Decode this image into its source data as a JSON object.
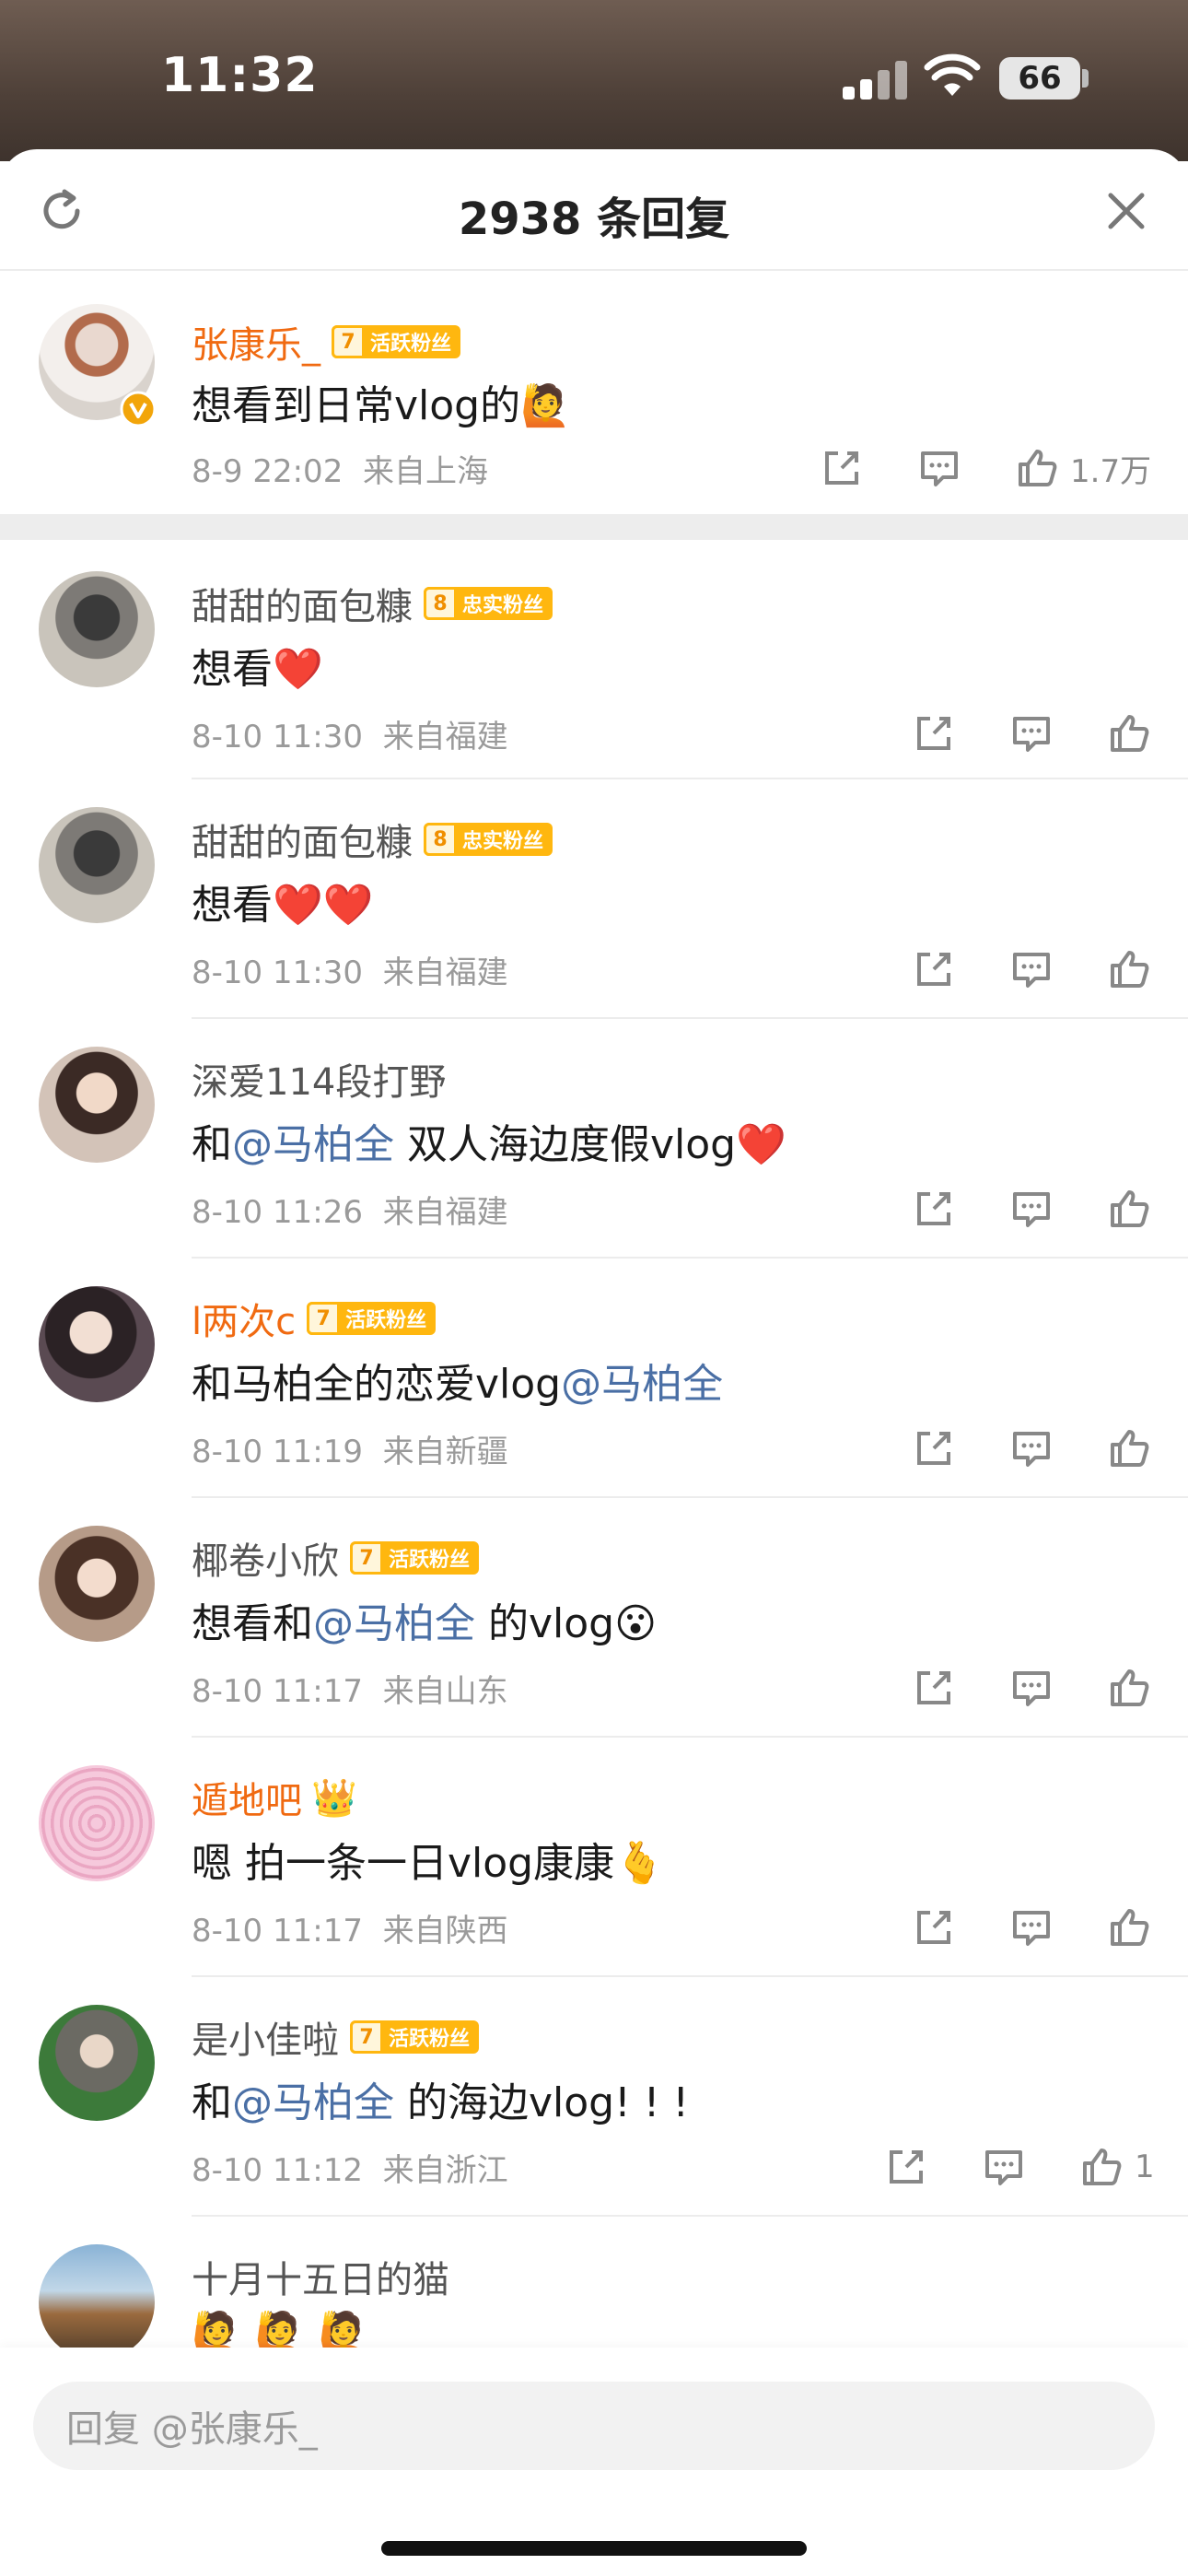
{
  "status": {
    "time": "11:32",
    "battery": "66"
  },
  "header": {
    "title": "2938 条回复"
  },
  "comments": [
    {
      "name": "张康乐_",
      "badge_level": "7",
      "badge_label": "活跃粉丝",
      "text": "想看到日常vlog的🙋",
      "date": "8-9 22:02",
      "location": "来自上海",
      "likes": "1.7万"
    },
    {
      "name": "甜甜的面包糠",
      "badge_level": "8",
      "badge_label": "忠实粉丝",
      "text": "想看❤️",
      "date": "8-10 11:30",
      "location": "来自福建"
    },
    {
      "name": "甜甜的面包糠",
      "badge_level": "8",
      "badge_label": "忠实粉丝",
      "text": "想看❤️❤️",
      "date": "8-10 11:30",
      "location": "来自福建"
    },
    {
      "name": "深爱114段打野",
      "text_before": "和",
      "mention": "@马柏全",
      "text_after": " 双人海边度假vlog❤️",
      "date": "8-10 11:26",
      "location": "来自福建"
    },
    {
      "name": "l两次c",
      "badge_level": "7",
      "badge_label": "活跃粉丝",
      "text_before": "和马柏全的恋爱vlog",
      "mention": "@马柏全",
      "date": "8-10 11:19",
      "location": "来自新疆"
    },
    {
      "name": "椰卷小欣",
      "badge_level": "7",
      "badge_label": "活跃粉丝",
      "text_before": "想看和",
      "mention": "@马柏全",
      "text_after": " 的vlog😮",
      "date": "8-10 11:17",
      "location": "来自山东"
    },
    {
      "name": "遁地吧",
      "crown": "👑",
      "text": "嗯 拍一条一日vlog康康🫰",
      "date": "8-10 11:17",
      "location": "来自陕西"
    },
    {
      "name": "是小佳啦",
      "badge_level": "7",
      "badge_label": "活跃粉丝",
      "text_before": "和",
      "mention": "@马柏全",
      "text_after": " 的海边vlog! ! !",
      "date": "8-10 11:12",
      "location": "来自浙江",
      "likes": "1"
    },
    {
      "name": "十月十五日的猫",
      "text": "🙋 🙋 🙋"
    }
  ],
  "reply": {
    "placeholder": "回复 @张康乐_"
  },
  "colors": {
    "accent_orange": "#f06a11",
    "mention_blue": "#4a6fa5",
    "badge_gold": "#ffb70f"
  },
  "icons": [
    "refresh-icon",
    "close-icon",
    "share-icon",
    "comment-icon",
    "like-icon",
    "verified-icon"
  ]
}
